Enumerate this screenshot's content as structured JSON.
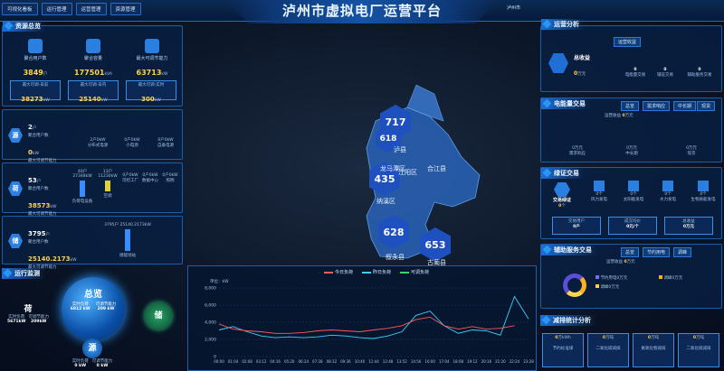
{
  "header": {
    "nav": [
      "可视化看板",
      "运行管理",
      "运营管理",
      "资源管理"
    ],
    "title": "泸州市虚拟电厂运营平台",
    "weather": "泸州市"
  },
  "resource_overview": {
    "title": "资源总览",
    "stats": [
      {
        "label": "聚合用户数",
        "value": "3849",
        "unit": "户"
      },
      {
        "label": "聚合容量",
        "value": "177501",
        "unit": "kVA"
      },
      {
        "label": "最大可调节能力",
        "value": "63713",
        "unit": "kW"
      }
    ],
    "sub": [
      {
        "label": "最大可调-日前",
        "value": "38273",
        "unit": "kW"
      },
      {
        "label": "最大可调-日内",
        "value": "25140",
        "unit": "kW"
      },
      {
        "label": "最大可调-实时",
        "value": "300",
        "unit": "kW"
      }
    ]
  },
  "source_block": {
    "icon": "源",
    "users": "2",
    "users_unit": "户",
    "users_label": "聚合用户数",
    "power": "0",
    "power_unit": "kW",
    "power_label": "最大可调节能力",
    "items": [
      {
        "label": "分布式电源",
        "value": "2户0kW"
      },
      {
        "label": "小电源",
        "value": "0户0kW"
      },
      {
        "label": "自备电源",
        "value": "0户0kW"
      }
    ]
  },
  "load_block": {
    "icon": "荷",
    "users": "53",
    "users_unit": "户",
    "users_label": "聚合用户数",
    "power": "38573",
    "power_unit": "kW",
    "power_label": "最大可调节能力",
    "items": [
      {
        "label": "负荷电设备",
        "value": "40户 27348kW"
      },
      {
        "label": "空调",
        "value": "13户 11230kW"
      },
      {
        "label": "可控工厂",
        "value": "0户0kW"
      },
      {
        "label": "数据中心",
        "value": "0户0kW"
      },
      {
        "label": "照明",
        "value": "0户0kW"
      }
    ]
  },
  "storage_block": {
    "icon": "储",
    "users": "3795",
    "users_unit": "户",
    "users_label": "聚合用户数",
    "power": "25140.2173",
    "power_unit": "kW",
    "power_label": "最大可调节能力",
    "items": [
      {
        "label": "储能场站",
        "value": "3795户 25140.2173kW"
      }
    ]
  },
  "operation_monitor": {
    "title": "运行监测",
    "center": {
      "title": "总览",
      "l1": "实时负荷",
      "v1": "6812 kW",
      "l2": "可调节能力",
      "v2": "209 kW"
    },
    "he": {
      "title": "荷",
      "l1": "实时负荷",
      "v1": "5671kW",
      "l2": "可调节能力",
      "v2": "209kW"
    },
    "chu": {
      "title": "储"
    },
    "yuan": {
      "title": "源",
      "l1": "实时负荷",
      "v1": "0 kW",
      "l2": "可调节能力",
      "v2": "0 kW"
    }
  },
  "map": {
    "markers": [
      {
        "value": "717",
        "unit": "户"
      },
      {
        "value": "618",
        "unit": "户"
      },
      {
        "value": "435",
        "unit": "户"
      },
      {
        "value": "628",
        "unit": "户"
      },
      {
        "value": "653",
        "unit": "户"
      }
    ],
    "labels": [
      "泸县",
      "龙马潭区",
      "江阳区",
      "合江县",
      "纳溪区",
      "叙永县",
      "古蔺县"
    ]
  },
  "chart_data": {
    "type": "line",
    "unit_label": "单位：kW",
    "series": [
      {
        "name": "今日负荷",
        "color": "#ff5a5a"
      },
      {
        "name": "昨日负荷",
        "color": "#3fd0ff"
      },
      {
        "name": "可调负荷",
        "color": "#36d86a"
      }
    ],
    "x": [
      "00:00",
      "01:04",
      "02:08",
      "03:12",
      "04:16",
      "05:20",
      "06:24",
      "07:28",
      "08:32",
      "09:36",
      "10:40",
      "11:44",
      "12:48",
      "13:52",
      "14:56",
      "16:00",
      "17:04",
      "18:08",
      "19:12",
      "20:16",
      "21:20",
      "22:24",
      "23:28"
    ],
    "ylim": [
      0,
      8000
    ],
    "yticks": [
      0,
      2000,
      4000,
      6000,
      8000
    ],
    "today": [
      3800,
      3200,
      3000,
      2900,
      2700,
      2700,
      2800,
      3000,
      3100,
      3000,
      2900,
      3100,
      3300,
      3600,
      4300,
      4600,
      3600,
      3200,
      3500,
      3200,
      3300,
      3600,
      null
    ],
    "yesterday": [
      3100,
      3500,
      2900,
      2400,
      2200,
      2300,
      2200,
      2300,
      2500,
      2400,
      2200,
      2100,
      2400,
      2900,
      4800,
      5300,
      3600,
      2700,
      3100,
      3000,
      2500,
      7000,
      4400
    ]
  },
  "operation_revenue": {
    "title": "运营分析",
    "total_label": "总收益",
    "total_value": "0",
    "total_unit": "万元",
    "tab": "运营收益",
    "items": [
      {
        "label": "电能量交易",
        "value": "0"
      },
      {
        "label": "辅证交易",
        "value": "0"
      },
      {
        "label": "辅助服务交易",
        "value": "0"
      }
    ]
  },
  "energy_trade": {
    "title": "电能量交易",
    "tabs": [
      "总览",
      "需求响应",
      "中长期",
      "现货"
    ],
    "revenue_label": "运营收益",
    "revenue_value": "0",
    "revenue_unit": "万元",
    "items": [
      {
        "label": "需求响应",
        "value": "0万元"
      },
      {
        "label": "中长期",
        "value": "0万元"
      },
      {
        "label": "现货",
        "value": "0万元"
      }
    ]
  },
  "cert_trade": {
    "title": "绿证交易",
    "main": "交易绿证",
    "main_value": "0",
    "main_unit": "个",
    "types": [
      {
        "label": "风力发电",
        "value": "0个"
      },
      {
        "label": "太阳能发电",
        "value": "0个"
      },
      {
        "label": "水力发电",
        "value": "0个"
      },
      {
        "label": "生物质能发电",
        "value": "0个"
      }
    ],
    "stats": [
      {
        "label": "交易用户",
        "value": "0户"
      },
      {
        "label": "成交均价",
        "value": "0元/个"
      },
      {
        "label": "总收益",
        "value": "0万元"
      }
    ]
  },
  "aux_trade": {
    "title": "辅助服务交易",
    "tabs": [
      "总览",
      "节约用电",
      "调峰"
    ],
    "revenue_label": "运营收益",
    "revenue_value": "0",
    "revenue_unit": "万元",
    "legend": [
      {
        "label": "节约用电0万元",
        "color": "#7b6bff"
      },
      {
        "label": "调峰0万元",
        "color": "#ffb020"
      },
      {
        "label": "调峰0万元",
        "color": "#ffd34d"
      }
    ]
  },
  "emission": {
    "title": "减排统计分析",
    "items": [
      {
        "value": "0",
        "unit": "万kWh",
        "label": "节约标准煤"
      },
      {
        "value": "0",
        "unit": "万吨",
        "label": "二氧化碳减排"
      },
      {
        "value": "0",
        "unit": "万吨",
        "label": "氮氧化物减排"
      },
      {
        "value": "0",
        "unit": "万吨",
        "label": "二氧化硫减排"
      }
    ]
  }
}
